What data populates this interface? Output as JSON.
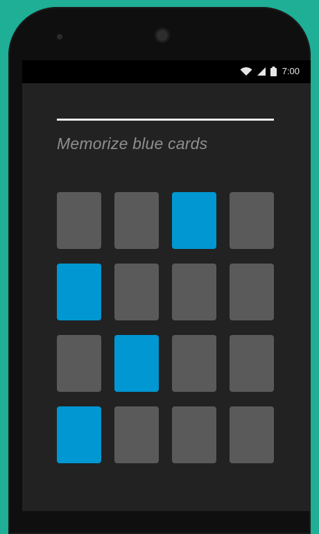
{
  "status_bar": {
    "time": "7:00",
    "icons": [
      "wifi-icon",
      "signal-icon",
      "battery-icon"
    ]
  },
  "progress": {
    "value": 1.0,
    "color": "#ececec"
  },
  "instruction": "Memorize blue cards",
  "colors": {
    "background": "#1fae96",
    "card_gray": "#5a5a5a",
    "card_blue": "#0097d2"
  },
  "grid": {
    "rows": 4,
    "cols": 4,
    "cards": [
      "gray",
      "gray",
      "blue",
      "gray",
      "blue",
      "gray",
      "gray",
      "gray",
      "gray",
      "blue",
      "gray",
      "gray",
      "blue",
      "gray",
      "gray",
      "gray"
    ]
  }
}
